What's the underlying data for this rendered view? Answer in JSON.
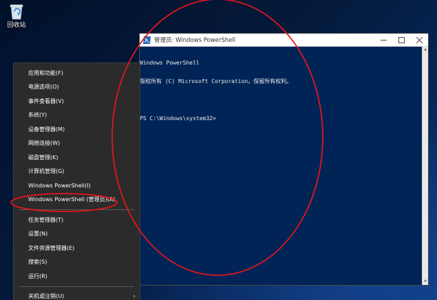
{
  "desktop": {
    "recycle_bin_label": "回收站"
  },
  "window": {
    "title": "管理员: Windows PowerShell",
    "console_lines": [
      "Windows PowerShell",
      "版权所有 (C) Microsoft Corporation。保留所有权利。",
      "",
      "PS C:\\Windows\\system32>"
    ]
  },
  "context_menu": {
    "group1": [
      "应用和功能(F)",
      "电源选项(O)",
      "事件查看器(V)",
      "系统(Y)",
      "设备管理器(M)",
      "网络连接(W)",
      "磁盘管理(K)",
      "计算机管理(G)",
      "Windows PowerShell(I)",
      "Windows PowerShell (管理员)(A)"
    ],
    "group2": [
      "任务管理器(T)",
      "设置(N)",
      "文件资源管理器(E)",
      "搜索(S)",
      "运行(R)"
    ],
    "group3": [
      "关机或注销(U)"
    ],
    "submenu_arrow": "›"
  },
  "colors": {
    "annotation": "#e4161b",
    "console_bg": "#012456",
    "menu_bg": "#2b2b2b"
  }
}
